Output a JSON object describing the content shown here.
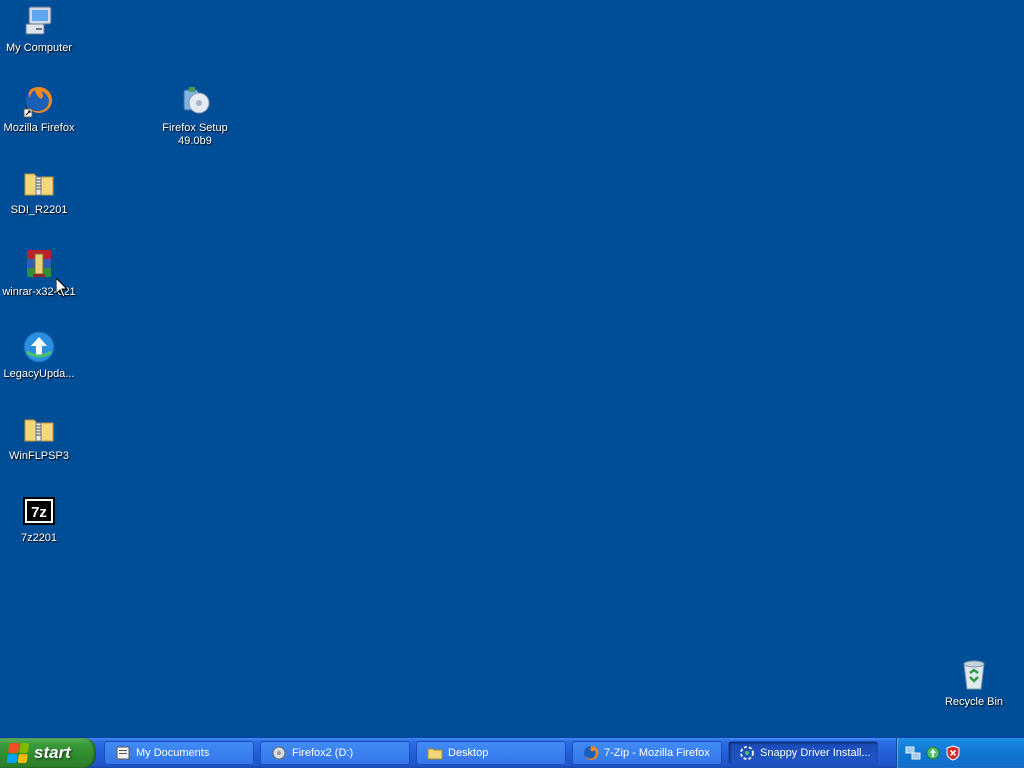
{
  "desktop": {
    "icons": [
      {
        "label": "My Computer",
        "icon": "my-computer-icon"
      },
      {
        "label": "Mozilla Firefox",
        "icon": "firefox-icon"
      },
      {
        "label": "Firefox Setup 49.0b9",
        "icon": "installer-icon"
      },
      {
        "label": "SDI_R2201",
        "icon": "zip-folder-icon"
      },
      {
        "label": "winrar-x32-621",
        "icon": "winrar-icon"
      },
      {
        "label": "LegacyUpda...",
        "icon": "legacy-update-icon"
      },
      {
        "label": "WinFLPSP3",
        "icon": "zip-folder-icon"
      },
      {
        "label": "7z2201",
        "icon": "7zip-icon"
      },
      {
        "label": "Recycle Bin",
        "icon": "recycle-bin-icon"
      }
    ]
  },
  "taskbar": {
    "start_label": "start",
    "tasks": [
      {
        "label": "My Documents",
        "icon": "documents-icon"
      },
      {
        "label": "Firefox2 (D:)",
        "icon": "drive-icon"
      },
      {
        "label": "Desktop",
        "icon": "folder-icon"
      },
      {
        "label": "7-Zip - Mozilla Firefox",
        "icon": "firefox-icon"
      },
      {
        "label": "Snappy Driver Install...",
        "icon": "snappy-driver-icon"
      }
    ]
  },
  "tray": {
    "icons": [
      "network-icon",
      "update-icon",
      "security-alert-icon"
    ]
  },
  "colors": {
    "desktop": "#004e98",
    "taskbar": "#235fd8",
    "start": "#3a9b3a"
  }
}
